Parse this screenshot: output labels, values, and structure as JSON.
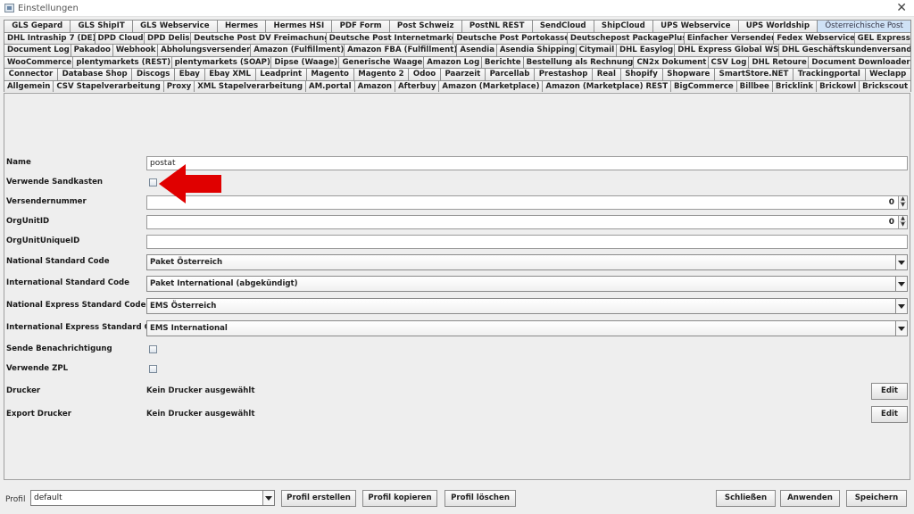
{
  "window": {
    "title": "Einstellungen"
  },
  "tabs": {
    "rows": [
      [
        "GLS Gepard",
        "GLS ShipIT",
        "GLS Webservice",
        "Hermes",
        "Hermes HSI",
        "PDF Form",
        "Post Schweiz",
        "PostNL REST",
        "SendCloud",
        "ShipCloud",
        "UPS Webservice",
        "UPS Worldship",
        "Österreichische Post"
      ],
      [
        "DHL Intraship 7 (DE)",
        "DPD Cloud",
        "DPD Delis",
        "Deutsche Post DV Freimachung",
        "Deutsche Post Internetmarke",
        "Deutsche Post Portokasse",
        "Deutschepost PackagePlus",
        "Einfacher Versender",
        "Fedex Webservice",
        "GEL Express"
      ],
      [
        "Document Log",
        "Pakadoo",
        "Webhook",
        "Abholungsversender",
        "Amazon (Fulfillment)",
        "Amazon FBA (Fulfillment)",
        "Asendia",
        "Asendia Shipping",
        "Citymail",
        "DHL Easylog",
        "DHL Express Global WS",
        "DHL Geschäftskundenversand"
      ],
      [
        "WooCommerce",
        "plentymarkets (REST)",
        "plentymarkets (SOAP)",
        "Dipse (Waage)",
        "Generische Waage",
        "Amazon Log",
        "Berichte",
        "Bestellung als Rechnung",
        "CN2x Dokument",
        "CSV Log",
        "DHL Retoure",
        "Document Downloader"
      ],
      [
        "Connector",
        "Database Shop",
        "Discogs",
        "Ebay",
        "Ebay XML",
        "Leadprint",
        "Magento",
        "Magento 2",
        "Odoo",
        "Paarzeit",
        "Parcellab",
        "Prestashop",
        "Real",
        "Shopify",
        "Shopware",
        "SmartStore.NET",
        "Trackingportal",
        "Weclapp"
      ],
      [
        "Allgemein",
        "CSV Stapelverarbeitung",
        "Proxy",
        "XML Stapelverarbeitung",
        "AM.portal",
        "Amazon",
        "Afterbuy",
        "Amazon (Marketplace)",
        "Amazon (Marketplace) REST",
        "BigCommerce",
        "Billbee",
        "Bricklink",
        "Brickowl",
        "Brickscout"
      ]
    ],
    "active": "Österreichische Post"
  },
  "form": {
    "name_label": "Name",
    "name_value": "postat",
    "sandbox_label": "Verwende Sandkasten",
    "sender_no_label": "Versendernummer",
    "sender_no_value": "0",
    "orgunit_label": "OrgUnitID",
    "orgunit_value": "0",
    "orgunit_unique_label": "OrgUnitUniqueID",
    "orgunit_unique_value": "",
    "national_label": "National Standard Code",
    "national_value": "Paket Österreich",
    "international_label": "International Standard Code",
    "international_value": "Paket International (abgekündigt)",
    "nat_express_label": "National Express Standard Code",
    "nat_express_value": "EMS Österreich",
    "int_express_label": "International Express Standard Code",
    "int_express_value": "EMS International",
    "notify_label": "Sende Benachrichtigung",
    "zpl_label": "Verwende ZPL",
    "printer_label": "Drucker",
    "printer_value": "Kein Drucker ausgewählt",
    "export_printer_label": "Export Drucker",
    "export_printer_value": "Kein Drucker ausgewählt",
    "edit_label": "Edit"
  },
  "annotation": {
    "color": "#e00000"
  },
  "footer": {
    "profil_label": "Profil",
    "profil_value": "default",
    "create_label": "Profil erstellen",
    "copy_label": "Profil kopieren",
    "delete_label": "Profil löschen",
    "close_label": "Schließen",
    "apply_label": "Anwenden",
    "save_label": "Speichern"
  }
}
